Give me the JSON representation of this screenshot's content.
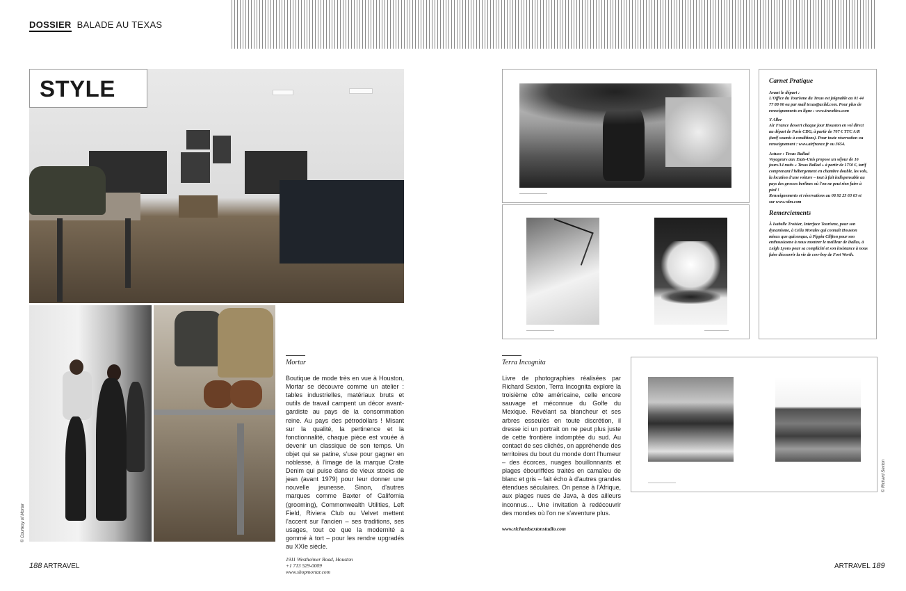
{
  "header": {
    "section": "DOSSIER",
    "subtitle": "BALADE AU TEXAS"
  },
  "left_page": {
    "style_label": "STYLE",
    "photo_credit": "© Courtesy of Mortar",
    "folio_number": "188",
    "folio_magazine": "ARTRAVEL"
  },
  "mortar": {
    "title": "Mortar",
    "body": "Boutique de mode très en vue à Houston, Mortar se découvre comme un atelier : tables industrielles, matériaux bruts et outils de travail campent un décor avant-gardiste au pays de la consommation reine. Au pays des pétrodollars ! Misant sur la qualité, la pertinence et la fonctionnalité, chaque pièce est vouée à devenir un classique de son temps. Un objet qui se patine, s'use pour gagner en noblesse, à l'image de la marque Crate Denim qui puise dans de vieux stocks de jean (avant 1979) pour leur donner une nouvelle jeunesse. Sinon, d'autres marques comme Baxter of California (grooming), Commonwealth Utilities, Left Field, Riviera Club ou Velvet mettent l'accent sur l'ancien – ses traditions, ses usages, tout ce que la modernité a gommé à tort – pour les rendre upgradés au XXIe siècle.",
    "address": "1911 Westheimer Road, Houston",
    "phone": "+1 713 529-0009",
    "web": "www.shopmortar.com"
  },
  "terra": {
    "title": "Terra Incognita",
    "body": "Livre de photographies réalisées par Richard Sexton, Terra Incognita explore la troisième côte américaine, celle encore sauvage et méconnue du Golfe du Mexique. Révélant sa blancheur et ses arbres esseulés en toute discrétion, il dresse ici un portrait on ne peut plus juste de cette frontière indomptée du sud. Au contact de ses clichés, on appréhende des territoires du bout du monde dont l'humeur – des écorces, nuages bouillonnants et plages ébouriffées traités en camaïeu de blanc et gris – fait écho à d'autres grandes étendues séculaires. On pense à l'Afrique, aux plages nues de Java, à des ailleurs inconnus… Une invitation à redécouvrir des mondes où l'on ne s'aventure plus.",
    "web": "www.richardsextonstudio.com"
  },
  "carnet": {
    "title": "Carnet Pratique",
    "avant_head": "Avant le départ :",
    "avant_body": "L'Office du Tourisme du Texas est joignable au 01 44 77 88 06 ou par mail texas@axiid.com. Pour plus de renseignements en ligne : www.traveltex.com",
    "aller_head": "Y Aller",
    "aller_body": "Air France dessert chaque jour Houston en vol direct au départ de Paris CDG, à partir de 707 € TTC A/R (tarif soumis à conditions). Pour toute réservation ou renseignement : www.airfrance.fr ou 3654.",
    "astuce_head": "Astuce : Texas Ballad",
    "astuce_body": "Voyageurs aux Etats-Unis propose un séjour de 16 jours/14 nuits « Texas Ballad » à partir de 1750 €, tarif comprenant l'hébergement en chambre double, les vols, la location d'une voiture – tout à fait indispensable au pays des grosses berlines où l'on ne peut rien faire à pied !",
    "astuce_info": "Renseignements et réservations au 08 92 23 63 63 et sur www.vdm.com",
    "merci_title": "Remerciements",
    "merci_body": "À Isabelle Troisier, Interface Tourisme, pour son dynamisme, à Celia Morales qui connaît Houston mieux que quiconque, à Pippin Clifton pour son enthousiasme à nous montrer le meilleur de Dallas, à Leigh Lyons pour sa complicité et son insistance à nous faire découvrir la vie de cow-boy de Fort Worth."
  },
  "right_page": {
    "photo_credit": "© Richard Sexton",
    "folio_magazine": "ARTRAVEL",
    "folio_number": "189"
  }
}
